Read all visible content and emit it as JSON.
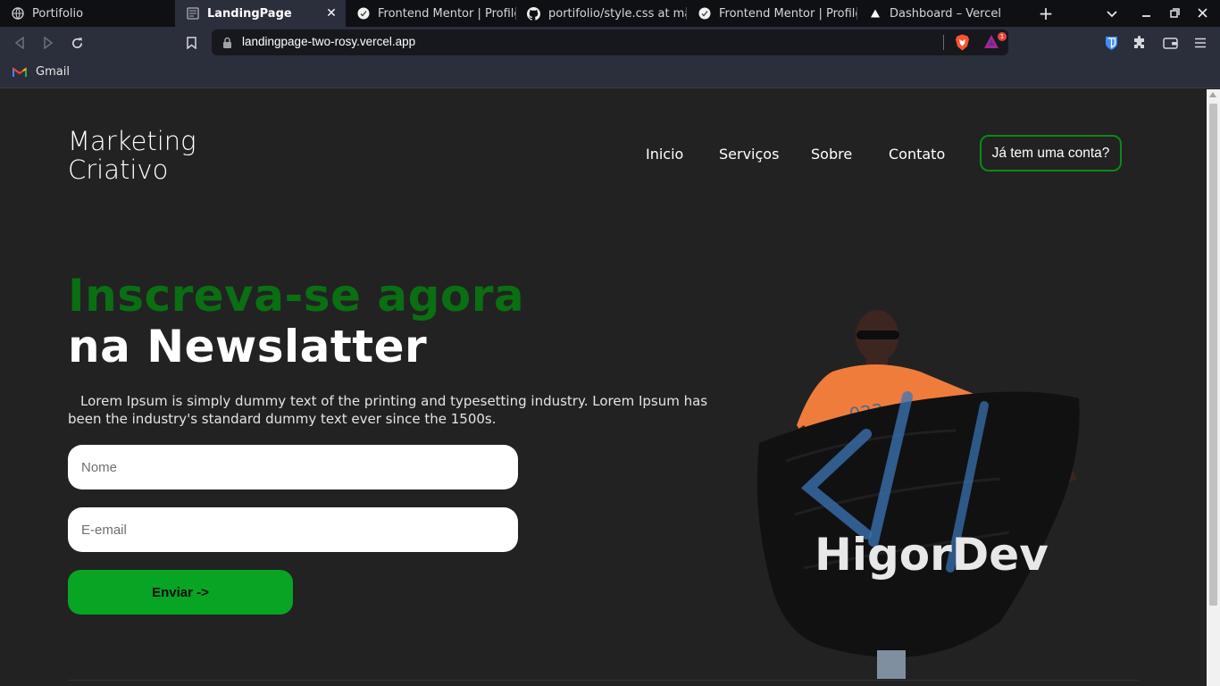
{
  "browser": {
    "tabs": [
      {
        "title": "Portifolio",
        "icon": "globe-icon",
        "active": false
      },
      {
        "title": "LandingPage",
        "icon": "page-icon",
        "active": true
      },
      {
        "title": "Frontend Mentor | Profile",
        "icon": "frontend-mentor-icon",
        "active": false
      },
      {
        "title": "portifolio/style.css at main",
        "icon": "github-icon",
        "active": false
      },
      {
        "title": "Frontend Mentor | Profile",
        "icon": "frontend-mentor-icon",
        "active": false
      },
      {
        "title": "Dashboard – Vercel",
        "icon": "vercel-icon",
        "active": false
      }
    ],
    "url": "landingpage-two-rosy.vercel.app",
    "rewards_badge": "1",
    "bookmarks": [
      {
        "label": "Gmail",
        "icon": "gmail-icon"
      }
    ]
  },
  "page": {
    "logo": {
      "line1": "Marketing",
      "line2": "Criativo"
    },
    "nav": [
      "Inicio",
      "Serviços",
      "Sobre",
      "Contato"
    ],
    "account_button": "Já tem uma conta?",
    "headline_green": "Inscreva-se agora",
    "headline_white": "na Newslatter",
    "lead": "Lorem Ipsum is simply dummy text of the printing and typesetting industry. Lorem Ipsum has been the industry's standard dummy text ever since the 1500s.",
    "form": {
      "name_placeholder": "Nome",
      "email_placeholder": "E-email",
      "submit_label": "Enviar ->"
    },
    "hero_image": {
      "banner_text": "HigorDev"
    }
  },
  "colors": {
    "accent_green": "#08a423",
    "headline_green": "#0a6e12",
    "page_bg": "#222222"
  }
}
